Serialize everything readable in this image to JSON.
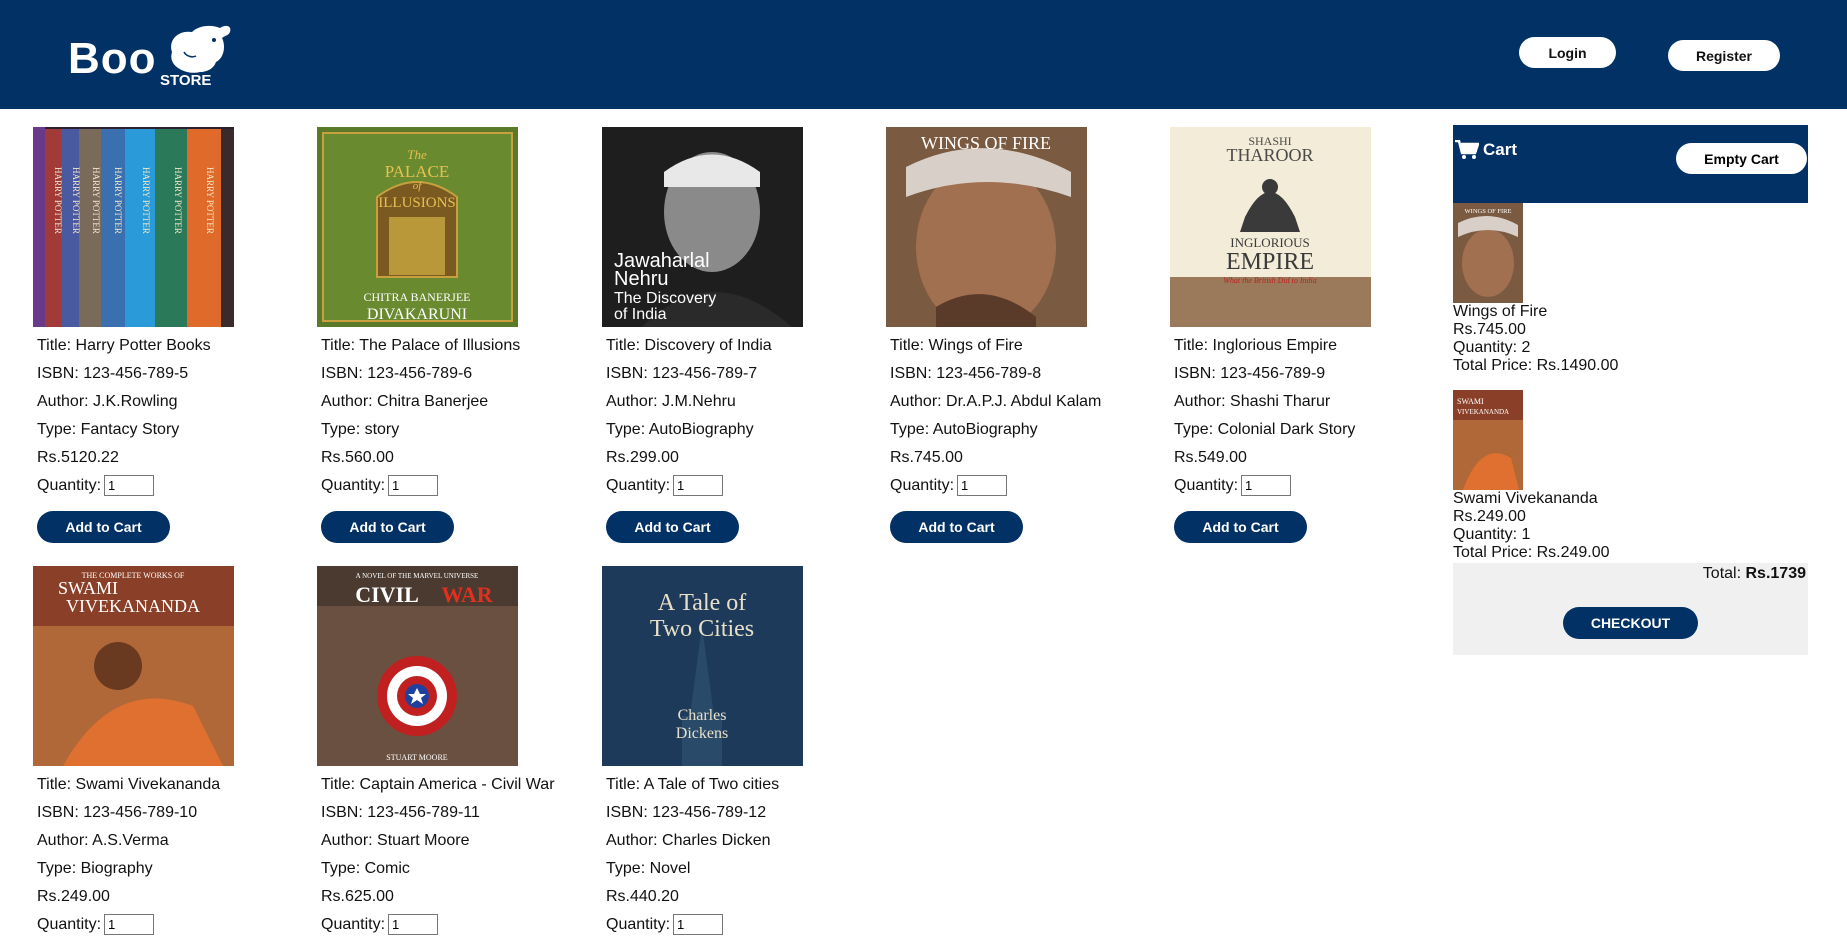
{
  "header": {
    "logo_text": "Boo",
    "logo_sub": "STORE",
    "login_label": "Login",
    "register_label": "Register"
  },
  "books": [
    {
      "title": "Title: Harry Potter Books",
      "isbn": "ISBN: 123-456-789-5",
      "author": "Author: J.K.Rowling",
      "type": "Type: Fantacy Story",
      "price": "Rs.5120.22",
      "qty_label": "Quantity:",
      "qty": "1",
      "add_label": "Add to Cart"
    },
    {
      "title": "Title: The Palace of Illusions",
      "isbn": "ISBN: 123-456-789-6",
      "author": "Author: Chitra Banerjee",
      "type": "Type: story",
      "price": "Rs.560.00",
      "qty_label": "Quantity:",
      "qty": "1",
      "add_label": "Add to Cart"
    },
    {
      "title": "Title: Discovery of India",
      "isbn": "ISBN: 123-456-789-7",
      "author": "Author: J.M.Nehru",
      "type": "Type: AutoBiography",
      "price": "Rs.299.00",
      "qty_label": "Quantity:",
      "qty": "1",
      "add_label": "Add to Cart"
    },
    {
      "title": "Title: Wings of Fire",
      "isbn": "ISBN: 123-456-789-8",
      "author": "Author: Dr.A.P.J. Abdul Kalam",
      "type": "Type: AutoBiography",
      "price": "Rs.745.00",
      "qty_label": "Quantity:",
      "qty": "1",
      "add_label": "Add to Cart"
    },
    {
      "title": "Title: Inglorious Empire",
      "isbn": "ISBN: 123-456-789-9",
      "author": "Author: Shashi Tharur",
      "type": "Type: Colonial Dark Story",
      "price": "Rs.549.00",
      "qty_label": "Quantity:",
      "qty": "1",
      "add_label": "Add to Cart"
    },
    {
      "title": "Title: Swami Vivekananda",
      "isbn": "ISBN: 123-456-789-10",
      "author": "Author: A.S.Verma",
      "type": "Type: Biography",
      "price": "Rs.249.00",
      "qty_label": "Quantity:",
      "qty": "1",
      "add_label": "Add to Cart"
    },
    {
      "title": "Title: Captain America - Civil War",
      "isbn": "ISBN: 123-456-789-11",
      "author": "Author: Stuart Moore",
      "type": "Type: Comic",
      "price": "Rs.625.00",
      "qty_label": "Quantity:",
      "qty": "1",
      "add_label": "Add to Cart"
    },
    {
      "title": "Title: A Tale of Two cities",
      "isbn": "ISBN: 123-456-789-12",
      "author": "Author: Charles Dicken",
      "type": "Type: Novel",
      "price": "Rs.440.20",
      "qty_label": "Quantity:",
      "qty": "1",
      "add_label": "Add to Cart"
    }
  ],
  "covers": {
    "palace": {
      "top": "The",
      "mid": "PALACE",
      "of": "of",
      "bot": "ILLUSIONS",
      "author1": "CHITRA BANERJEE",
      "author2": "DIVAKARUNI"
    },
    "nehru": {
      "name1": "Jawaharlal",
      "name2": "Nehru",
      "sub1": "The Discovery",
      "sub2": "of India"
    },
    "wings": {
      "title": "WINGS OF FIRE"
    },
    "empire": {
      "a1": "SHASHI",
      "a2": "THAROOR",
      "t1": "INGLORIOUS",
      "t2": "EMPIRE",
      "sub": "What the British Did to India"
    },
    "swami": {
      "top": "THE COMPLETE WORKS OF",
      "n1": "SWAMI",
      "n2": "VIVEKANANDA"
    },
    "civil": {
      "top": "A NOVEL OF THE MARVEL UNIVERSE",
      "t1": "CIVIL",
      "t2": "WAR",
      "author": "STUART MOORE"
    },
    "tale": {
      "l1": "A Tale of",
      "l2": "Two Cities",
      "a1": "Charles",
      "a2": "Dickens"
    },
    "harry": {
      "spine": "HARRY POTTER"
    }
  },
  "cart": {
    "title": "Cart",
    "empty_label": "Empty Cart",
    "items": [
      {
        "name": "Wings of Fire",
        "price": "Rs.745.00",
        "qty": "Quantity: 2",
        "total": "Total Price: Rs.1490.00"
      },
      {
        "name": "Swami Vivekananda",
        "price": "Rs.249.00",
        "qty": "Quantity: 1",
        "total": "Total Price: Rs.249.00"
      }
    ],
    "total_label": "Total:",
    "total_value": "Rs.1739",
    "checkout_label": "CHECKOUT"
  },
  "colors": {
    "brand": "#023166",
    "footer_bg": "#f0f0f0"
  }
}
